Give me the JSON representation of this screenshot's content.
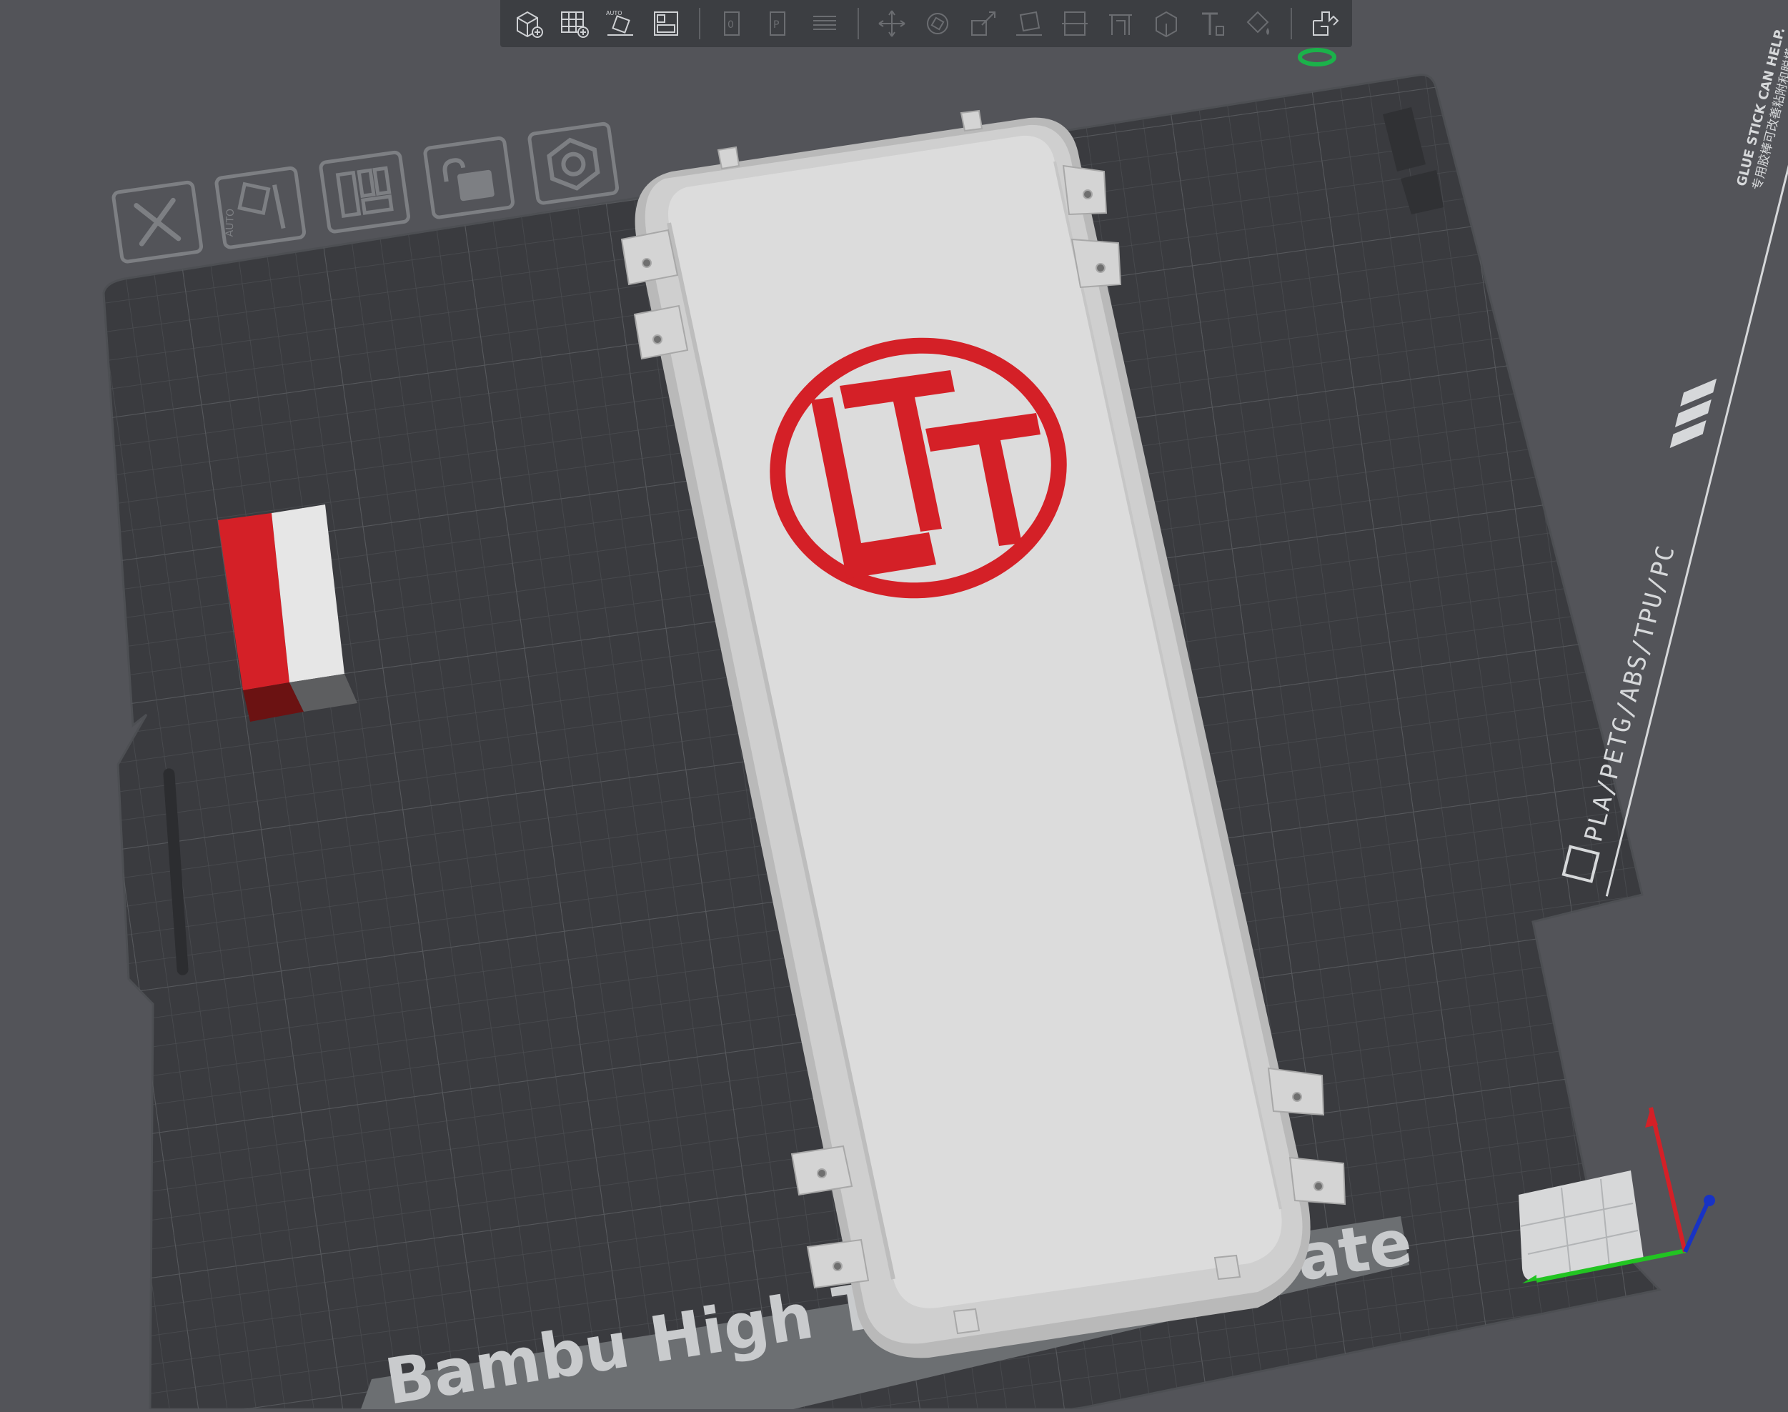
{
  "app": {
    "view": "Prepare - plate 3D view"
  },
  "toolbar": {
    "buttons": [
      {
        "name": "add-object-button",
        "icon": "cube-plus-icon",
        "enabled": true
      },
      {
        "name": "add-plate-button",
        "icon": "grid-plus-icon",
        "enabled": true
      },
      {
        "name": "auto-orient-button",
        "icon": "auto-orient-icon",
        "enabled": true,
        "label": "AUTO"
      },
      {
        "name": "arrange-button",
        "icon": "arrange-icon",
        "enabled": true
      },
      {
        "name": "split-objects-button",
        "icon": "split-objects-icon",
        "enabled": false
      },
      {
        "name": "split-parts-button",
        "icon": "split-parts-icon",
        "enabled": false
      },
      {
        "name": "layers-button",
        "icon": "layers-icon",
        "enabled": false
      },
      {
        "name": "move-button",
        "icon": "move-icon",
        "enabled": false
      },
      {
        "name": "rotate-button",
        "icon": "rotate-icon",
        "enabled": false
      },
      {
        "name": "scale-button",
        "icon": "scale-icon",
        "enabled": false
      },
      {
        "name": "lay-on-face-button",
        "icon": "lay-on-face-icon",
        "enabled": false
      },
      {
        "name": "cut-button",
        "icon": "cut-icon",
        "enabled": false
      },
      {
        "name": "support-paint-button",
        "icon": "support-paint-icon",
        "enabled": false
      },
      {
        "name": "seam-paint-button",
        "icon": "seam-paint-icon",
        "enabled": false
      },
      {
        "name": "text-button",
        "icon": "text-emboss-icon",
        "enabled": false
      },
      {
        "name": "color-paint-button",
        "icon": "color-paint-icon",
        "enabled": false
      },
      {
        "name": "assembly-view-button",
        "icon": "assembly-icon",
        "enabled": true
      }
    ]
  },
  "plate_toolbar": {
    "buttons": [
      {
        "name": "plate-delete-button",
        "icon": "close-icon"
      },
      {
        "name": "plate-auto-orient-button",
        "icon": "auto-orient-icon",
        "label": "AUTO"
      },
      {
        "name": "plate-arrange-button",
        "icon": "arrange-icon"
      },
      {
        "name": "plate-lock-button",
        "icon": "lock-icon"
      },
      {
        "name": "plate-settings-button",
        "icon": "hex-nut-icon"
      }
    ]
  },
  "build_plate": {
    "imprint_main": "Bambu High Temperature Plate",
    "imprint_visible_left": "Bambu High Te",
    "imprint_visible_right": "ate",
    "side_text": "PLA/PETG/ABS/TPU/PC",
    "side_glue_text": "GLUE STICK CAN HELP.",
    "side_glue_text_cn": "专用胶棒可改善粘附和脱模"
  },
  "objects": {
    "enclosure_logo": "LTT",
    "colors": {
      "plate": "#3a3b3f",
      "grid": "#4a4c50",
      "model": "#dcdcdc",
      "logo_red": "#d42027",
      "background": "#535459"
    }
  },
  "axes": {
    "x_color": "#22c422",
    "y_color": "#d42027",
    "z_color": "#1833c4"
  }
}
